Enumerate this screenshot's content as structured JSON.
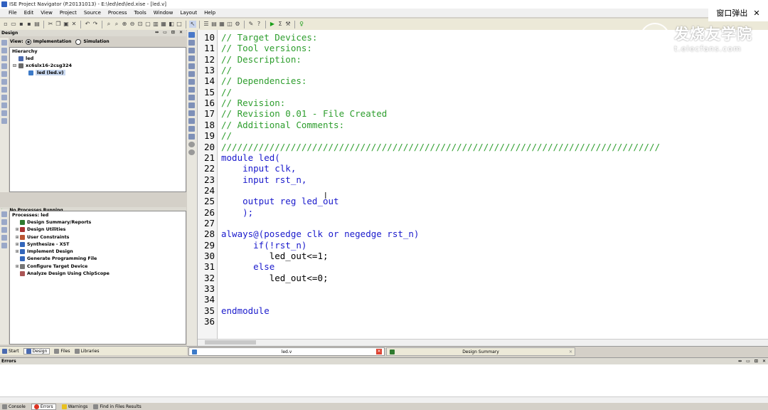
{
  "window": {
    "title": "ISE Project Navigator (P.20131013) - E:\\led\\led\\led.xise - [led.v]"
  },
  "menu": [
    "File",
    "Edit",
    "View",
    "Project",
    "Source",
    "Process",
    "Tools",
    "Window",
    "Layout",
    "Help"
  ],
  "popup": {
    "label": "窗口弹出",
    "close": "✕"
  },
  "watermark": {
    "brand": "发烧友学院",
    "url": "t.elecfans.com"
  },
  "design_panel": {
    "title": "Design",
    "view_label": "View:",
    "implementation_label": "Implementation",
    "simulation_label": "Simulation",
    "hierarchy_title": "Hierarchy",
    "hierarchy": [
      "led",
      "xc6slx16-2csg324",
      "led (led.v)"
    ]
  },
  "process_panel": {
    "status": "No Processes Running",
    "title": "Processes: led",
    "items": [
      "Design Summary/Reports",
      "Design Utilities",
      "User Constraints",
      "Synthesize - XST",
      "Implement Design",
      "Generate Programming File",
      "Configure Target Device",
      "Analyze Design Using ChipScope"
    ]
  },
  "left_tabs": [
    "Start",
    "Design",
    "Files",
    "Libraries"
  ],
  "editor": {
    "lines": [
      {
        "n": "10",
        "t": "// Target Devices:",
        "c": "cm"
      },
      {
        "n": "11",
        "t": "// Tool versions:",
        "c": "cm"
      },
      {
        "n": "12",
        "t": "// Description:",
        "c": "cm"
      },
      {
        "n": "13",
        "t": "//",
        "c": "cm"
      },
      {
        "n": "14",
        "t": "// Dependencies:",
        "c": "cm"
      },
      {
        "n": "15",
        "t": "//",
        "c": "cm"
      },
      {
        "n": "16",
        "t": "// Revision:",
        "c": "cm"
      },
      {
        "n": "17",
        "t": "// Revision 0.01 - File Created",
        "c": "cm"
      },
      {
        "n": "18",
        "t": "// Additional Comments:",
        "c": "cm"
      },
      {
        "n": "19",
        "t": "//",
        "c": "cm"
      },
      {
        "n": "20",
        "t": "//////////////////////////////////////////////////////////////////////////////////",
        "c": "cm"
      },
      {
        "n": "21",
        "t": "module led(",
        "c": "kw"
      },
      {
        "n": "22",
        "t": "    input clk,",
        "c": "kw"
      },
      {
        "n": "23",
        "t": "    input rst_n,",
        "c": "kw"
      },
      {
        "n": "24",
        "t": "",
        "c": ""
      },
      {
        "n": "25",
        "t": "    output reg led_out",
        "c": "kw"
      },
      {
        "n": "26",
        "t": "    );",
        "c": "kw"
      },
      {
        "n": "27",
        "t": "",
        "c": ""
      },
      {
        "n": "28",
        "t": "always@(posedge clk or negedge rst_n)",
        "c": "kw"
      },
      {
        "n": "29",
        "t": "      if(!rst_n)",
        "c": "kw"
      },
      {
        "n": "30",
        "t": "         led_out<=1;",
        "c": ""
      },
      {
        "n": "31",
        "t": "      else",
        "c": "kw"
      },
      {
        "n": "32",
        "t": "         led_out<=0;",
        "c": ""
      },
      {
        "n": "33",
        "t": "",
        "c": ""
      },
      {
        "n": "34",
        "t": "",
        "c": ""
      },
      {
        "n": "35",
        "t": "endmodule",
        "c": "kw"
      },
      {
        "n": "36",
        "t": "",
        "c": ""
      }
    ]
  },
  "editor_tabs": [
    "led.v",
    "Design Summary"
  ],
  "errors_panel": {
    "title": "Errors"
  },
  "bottom_tabs": [
    "Console",
    "Errors",
    "Warnings",
    "Find in Files Results"
  ],
  "colors": {
    "comment": "#2e9e2e",
    "keyword": "#1a1acc"
  }
}
